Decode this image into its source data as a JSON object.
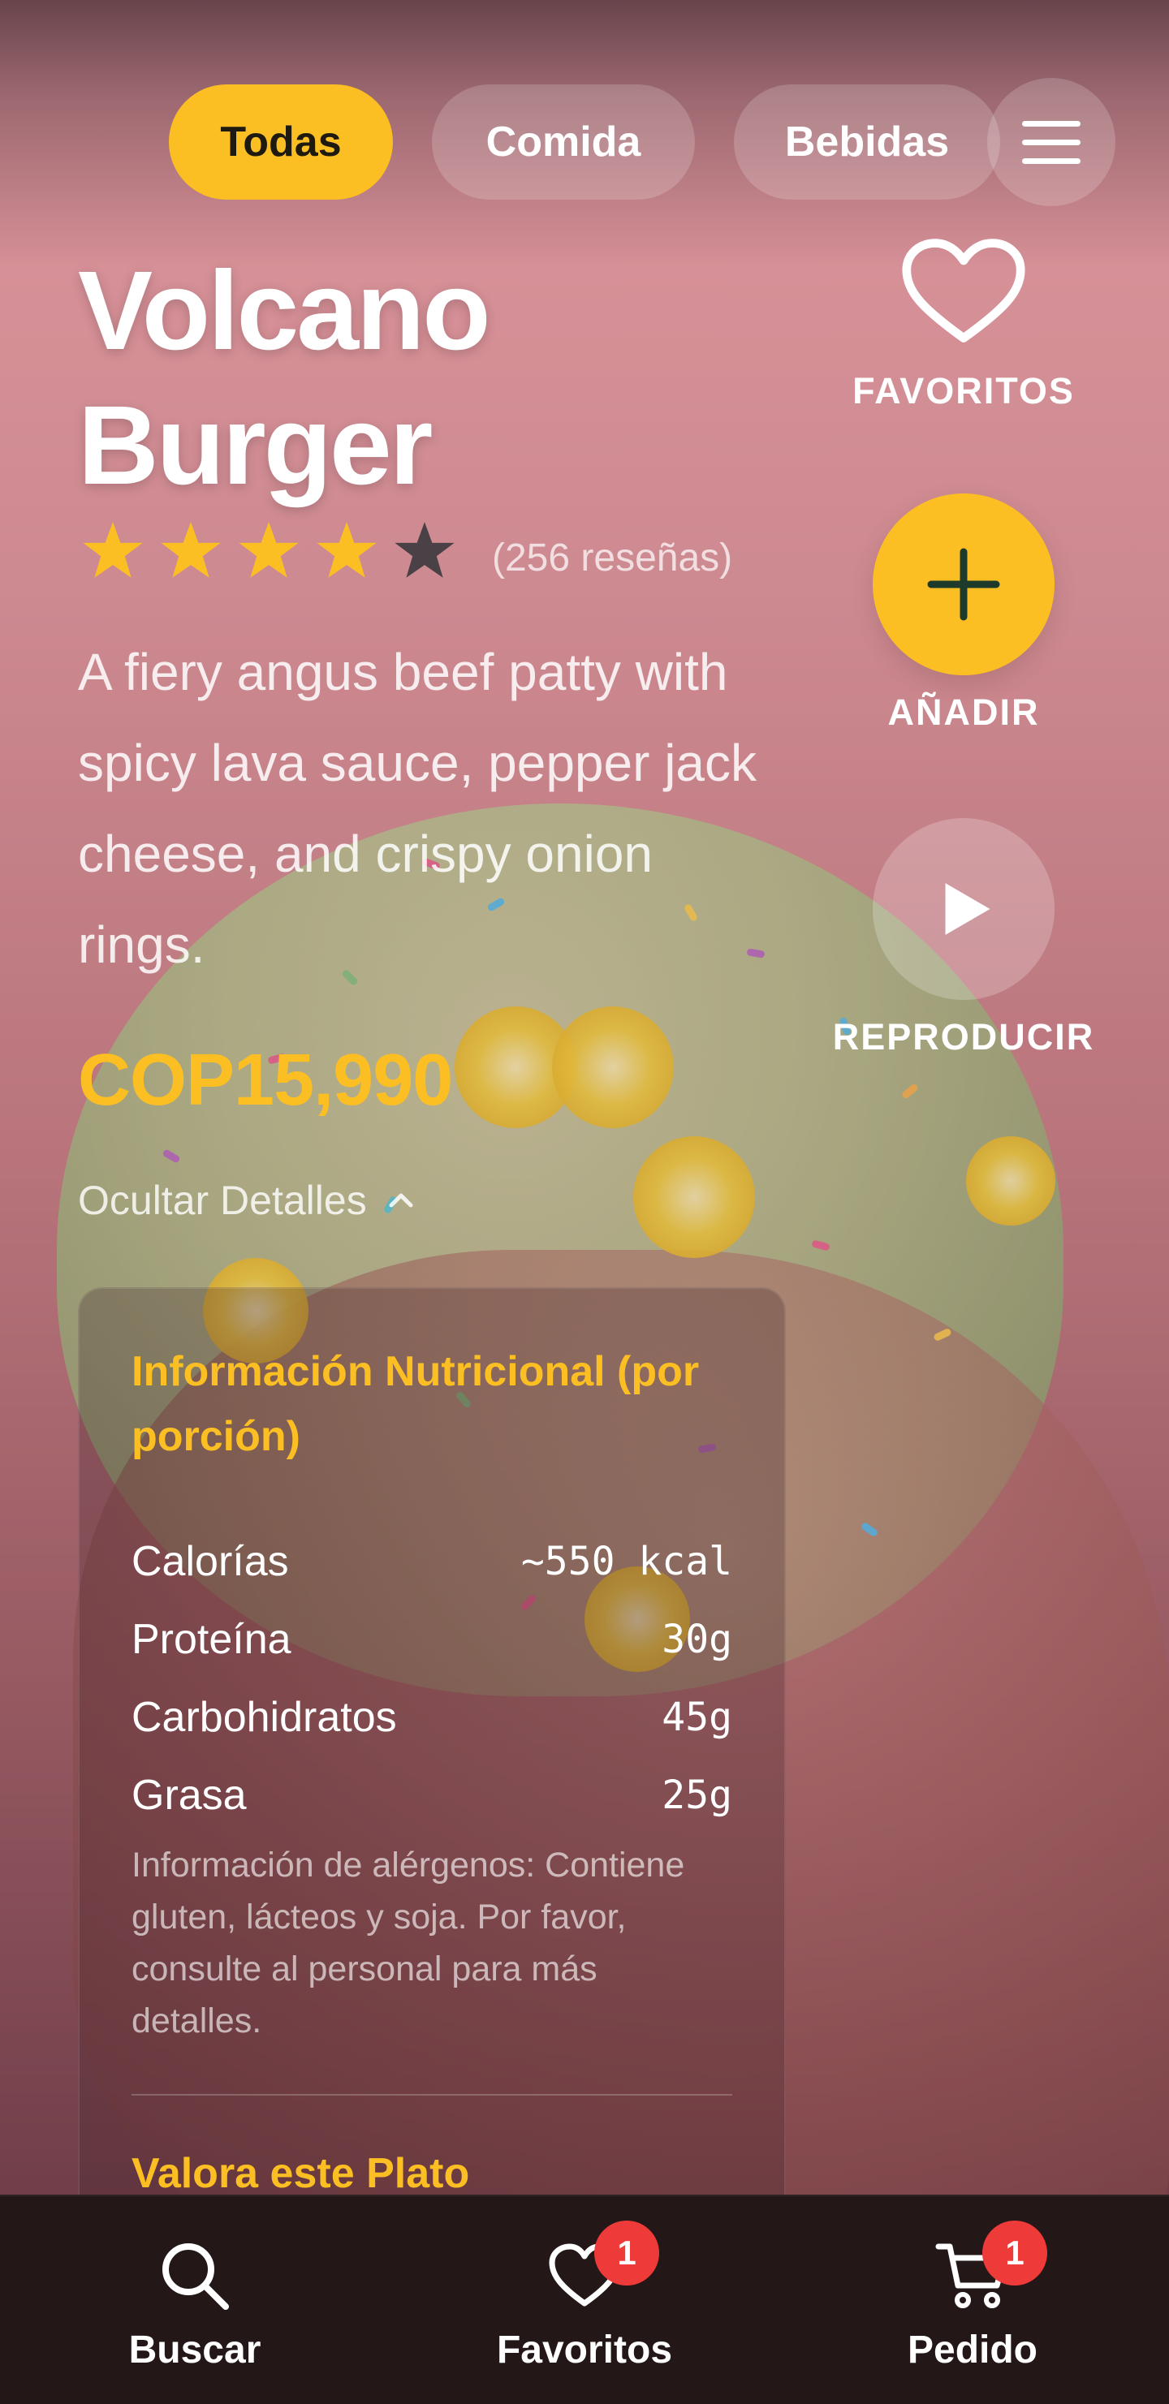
{
  "tabs": [
    {
      "label": "Todas",
      "active": true
    },
    {
      "label": "Comida",
      "active": false
    },
    {
      "label": "Bebidas",
      "active": false
    }
  ],
  "menu_icon": "hamburger-menu-icon",
  "product": {
    "name": "Volcano Burger",
    "rating": 4,
    "rating_max": 5,
    "reviews": "(256 reseñas)",
    "description": "A fiery angus beef patty with spicy lava sauce, pepper jack cheese, and crispy onion rings.",
    "price": "COP15,990",
    "toggle_details": "Ocultar Detalles"
  },
  "nutrition": {
    "title": "Información Nutricional (por porción)",
    "rows": [
      {
        "label": "Calorías",
        "value": "~550 kcal"
      },
      {
        "label": "Proteína",
        "value": "30g"
      },
      {
        "label": "Carbohidratos",
        "value": "45g"
      },
      {
        "label": "Grasa",
        "value": "25g"
      }
    ],
    "allergens": "Información de alérgenos: Contiene gluten, lácteos y soja. Por favor, consulte al personal para más detalles.",
    "rate_title": "Valora este Plato"
  },
  "actions": {
    "favorites": "FAVORITOS",
    "add": "AÑADIR",
    "play": "REPRODUCIR"
  },
  "bottom_nav": [
    {
      "label": "Buscar",
      "icon": "search-icon"
    },
    {
      "label": "Favoritos",
      "icon": "heart-icon",
      "badge": "1"
    },
    {
      "label": "Pedido",
      "icon": "cart-icon",
      "badge": "1"
    }
  ],
  "colors": {
    "accent": "#fbbf24",
    "badge": "#ef3a3a",
    "nav_bg": "#241718"
  }
}
